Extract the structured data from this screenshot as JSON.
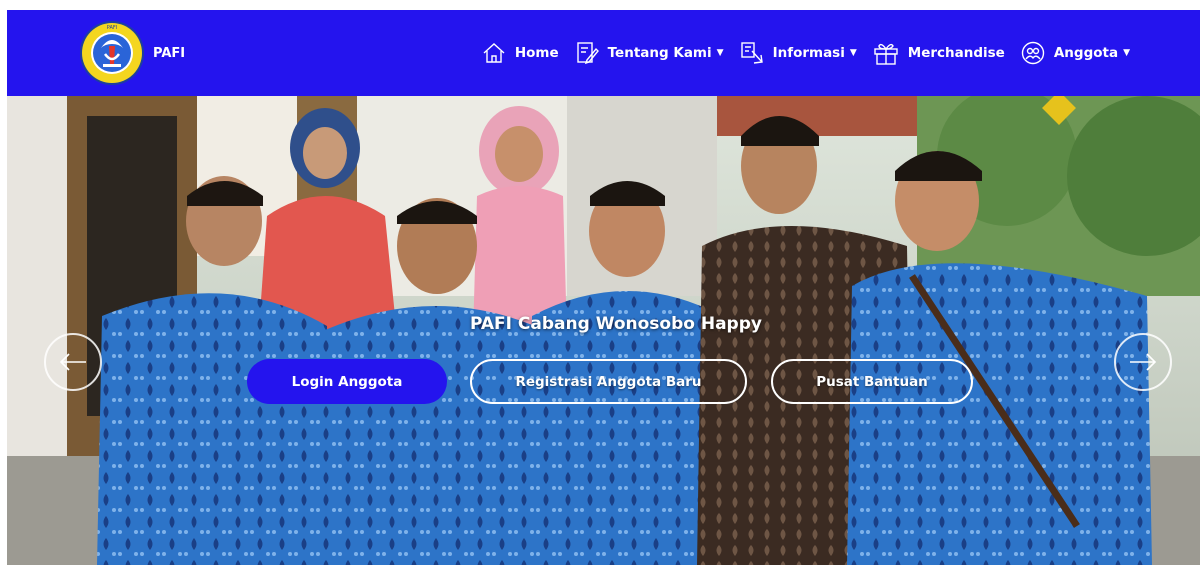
{
  "brand": {
    "name": "PAFI",
    "logo_text": "PERSATUAN AHLI FARMASI INDONESIA"
  },
  "nav": {
    "items": [
      {
        "label": "Home",
        "icon": "home-icon",
        "dropdown": false
      },
      {
        "label": "Tentang Kami",
        "icon": "edit-document-icon",
        "dropdown": true
      },
      {
        "label": "Informasi",
        "icon": "info-pointer-icon",
        "dropdown": true
      },
      {
        "label": "Merchandise",
        "icon": "gift-icon",
        "dropdown": false
      },
      {
        "label": "Anggota",
        "icon": "members-icon",
        "dropdown": true
      }
    ]
  },
  "hero": {
    "title": "PAFI Cabang Wonosobo Happy",
    "buttons": {
      "login": "Login Anggota",
      "register": "Registrasi Anggota Baru",
      "help": "Pusat Bantuan"
    }
  },
  "colors": {
    "primary": "#2414ee",
    "text_light": "#ffffff"
  }
}
